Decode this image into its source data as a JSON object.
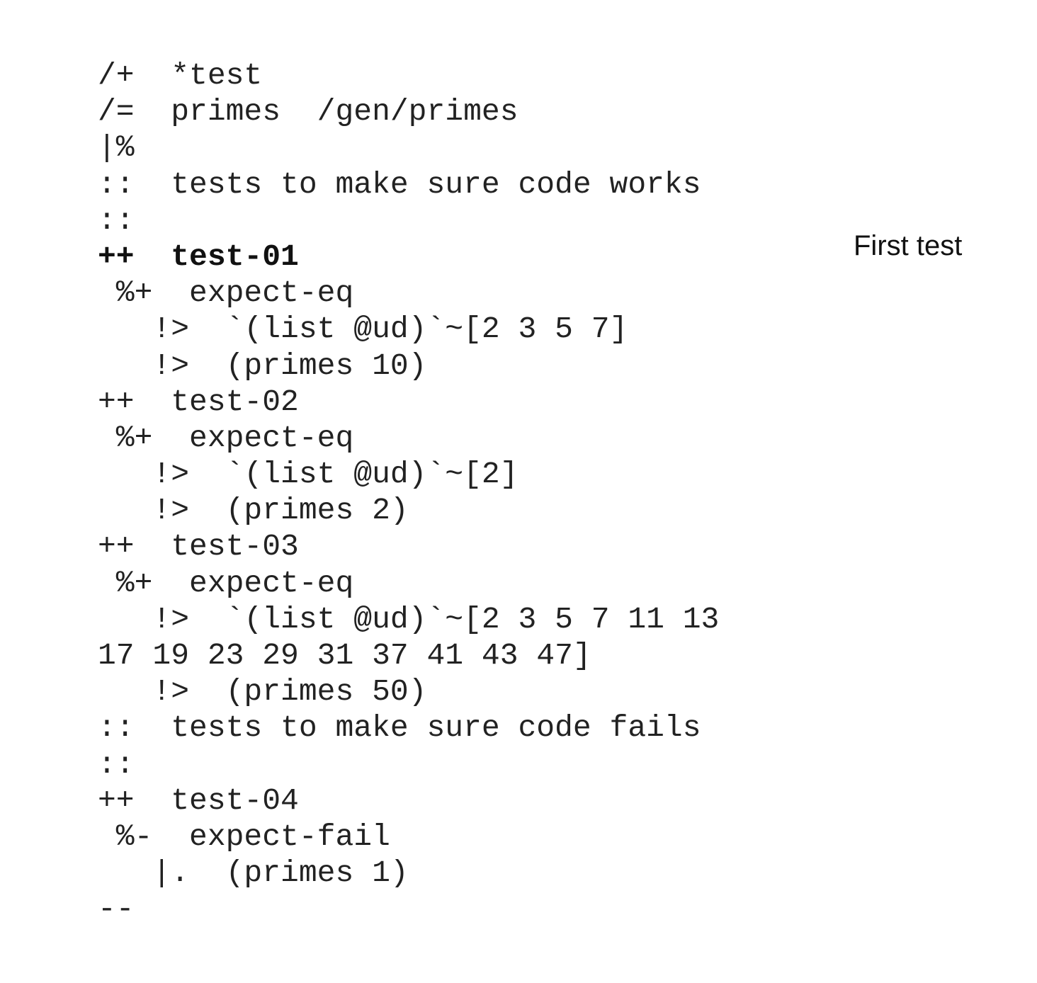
{
  "code": {
    "lines": [
      {
        "text": "/+  *test",
        "bold": false
      },
      {
        "text": "/=  primes  /gen/primes",
        "bold": false
      },
      {
        "text": "|%",
        "bold": false
      },
      {
        "text": "::  tests to make sure code works",
        "bold": false
      },
      {
        "text": "::",
        "bold": false
      },
      {
        "text": "++  test-01",
        "bold": true
      },
      {
        "text": " %+  expect-eq",
        "bold": false
      },
      {
        "text": "   !>  `(list @ud)`~[2 3 5 7]",
        "bold": false
      },
      {
        "text": "   !>  (primes 10)",
        "bold": false
      },
      {
        "text": "++  test-02",
        "bold": false
      },
      {
        "text": " %+  expect-eq",
        "bold": false
      },
      {
        "text": "   !>  `(list @ud)`~[2]",
        "bold": false
      },
      {
        "text": "   !>  (primes 2)",
        "bold": false
      },
      {
        "text": "++  test-03",
        "bold": false
      },
      {
        "text": " %+  expect-eq",
        "bold": false
      },
      {
        "text": "   !>  `(list @ud)`~[2 3 5 7 11 13",
        "bold": false
      },
      {
        "text": "17 19 23 29 31 37 41 43 47]",
        "bold": false
      },
      {
        "text": "   !>  (primes 50)",
        "bold": false
      },
      {
        "text": "::  tests to make sure code fails",
        "bold": false
      },
      {
        "text": "::",
        "bold": false
      },
      {
        "text": "++  test-04",
        "bold": false
      },
      {
        "text": " %-  expect-fail",
        "bold": false
      },
      {
        "text": "   |.  (primes 1)",
        "bold": false
      },
      {
        "text": "--",
        "bold": false
      }
    ]
  },
  "annotation": {
    "text": "First test"
  }
}
